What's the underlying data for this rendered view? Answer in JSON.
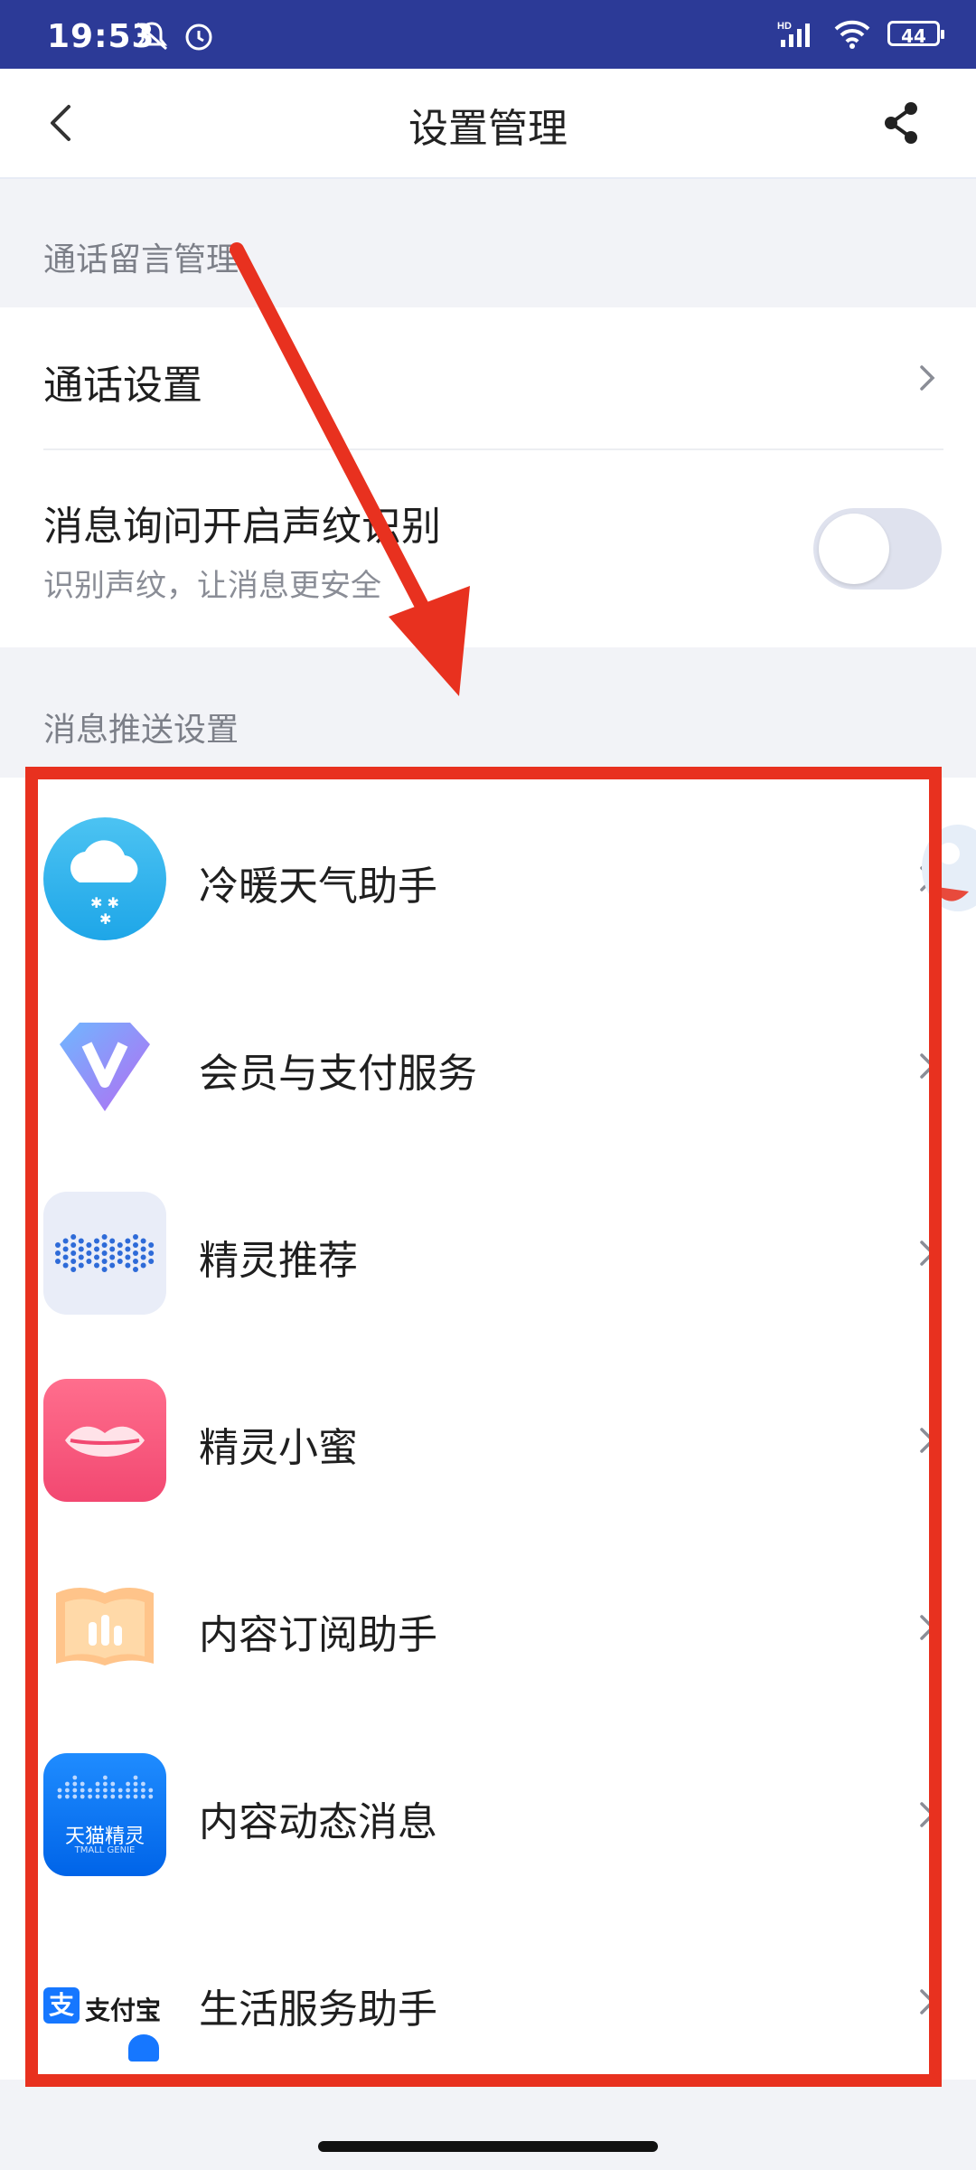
{
  "status_bar": {
    "time": "19:53",
    "battery": "44",
    "icons": [
      "mute-icon",
      "alarm-icon",
      "signal-icon",
      "wifi-icon",
      "battery-icon"
    ]
  },
  "header": {
    "title": "设置管理",
    "back_icon": "back-icon",
    "share_icon": "share-icon"
  },
  "section1": {
    "title": "通话留言管理",
    "rows": [
      {
        "title": "通话设置"
      },
      {
        "title": "消息询问开启声纹识别",
        "subtitle": "识别声纹，让消息更安全",
        "toggle_on": false
      }
    ]
  },
  "section2": {
    "title": "消息推送设置",
    "items": [
      {
        "label": "冷暖天气助手",
        "icon": "weather-cloud-icon"
      },
      {
        "label": "会员与支付服务",
        "icon": "diamond-vip-icon"
      },
      {
        "label": "精灵推荐",
        "icon": "soundwave-icon"
      },
      {
        "label": "精灵小蜜",
        "icon": "lips-icon"
      },
      {
        "label": "内容订阅助手",
        "icon": "book-chart-icon"
      },
      {
        "label": "内容动态消息",
        "icon": "tmall-genie-icon",
        "icon_text": "天猫精灵",
        "icon_subtext": "TMALL GENIE"
      },
      {
        "label": "生活服务助手",
        "icon": "alipay-icon",
        "icon_text": "支付宝"
      }
    ]
  },
  "colors": {
    "status_bar_bg": "#2c3a97",
    "annotation_red": "#e8311f",
    "page_bg": "#f2f3f7"
  }
}
